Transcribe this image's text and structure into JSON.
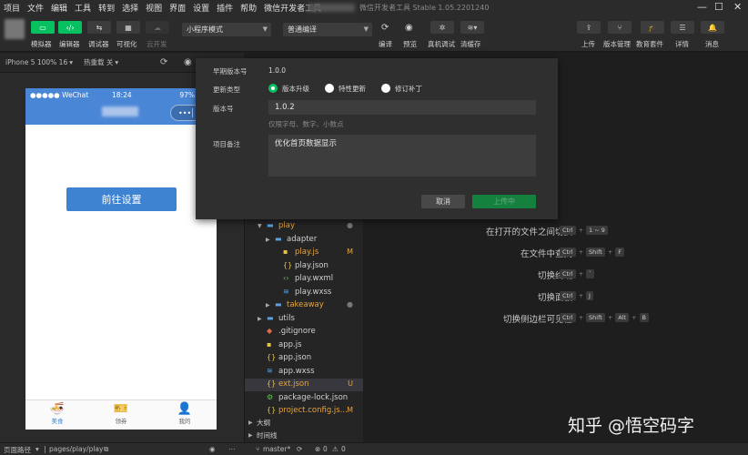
{
  "menubar": {
    "items": [
      "项目",
      "文件",
      "编辑",
      "工具",
      "转到",
      "选择",
      "视图",
      "界面",
      "设置",
      "插件",
      "帮助",
      "微信开发者工具"
    ],
    "app_title": "微信开发者工具 Stable 1.05.2201240"
  },
  "toolbar": {
    "simulator": "模拟器",
    "editor": "编辑器",
    "debugger": "调试器",
    "visual": "可视化",
    "cloud": "云开发",
    "mode_select": "小程序模式",
    "compile_select": "普通编译",
    "compile": "编译",
    "preview": "预览",
    "remote_debug": "真机调试",
    "clear_cache": "清缓存",
    "upload": "上传",
    "version": "版本管理",
    "edu": "教育套件",
    "details": "详情",
    "messages": "消息"
  },
  "simbar": {
    "device": "iPhone 5 100% 16",
    "hotreload": "热重载 关"
  },
  "phone": {
    "carrier": "●●●●● WeChat",
    "time": "18:24",
    "battery": "97%",
    "goto_button": "前往设置",
    "tabs": [
      {
        "icon": "bowl-icon",
        "glyph": "🍜",
        "label": "美食"
      },
      {
        "icon": "coupon-icon",
        "glyph": "🎫",
        "label": "领券"
      },
      {
        "icon": "user-icon",
        "glyph": "👤",
        "label": "我的"
      }
    ]
  },
  "filetree": {
    "rows": [
      {
        "name": "play",
        "kind": "folder",
        "status": "●"
      },
      {
        "name": "adapter",
        "kind": "folder",
        "status": ""
      },
      {
        "name": "play.js",
        "kind": "js",
        "status": "M"
      },
      {
        "name": "play.json",
        "kind": "json",
        "status": ""
      },
      {
        "name": "play.wxml",
        "kind": "wxml",
        "status": ""
      },
      {
        "name": "play.wxss",
        "kind": "wxss",
        "status": ""
      },
      {
        "name": "takeaway",
        "kind": "folder",
        "status": "●"
      },
      {
        "name": "utils",
        "kind": "folder",
        "status": ""
      },
      {
        "name": ".gitignore",
        "kind": "git",
        "status": ""
      },
      {
        "name": "app.js",
        "kind": "js",
        "status": ""
      },
      {
        "name": "app.json",
        "kind": "json",
        "status": ""
      },
      {
        "name": "app.wxss",
        "kind": "wxss",
        "status": ""
      },
      {
        "name": "ext.json",
        "kind": "json",
        "status": "U"
      },
      {
        "name": "package-lock.json",
        "kind": "pkg",
        "status": ""
      },
      {
        "name": "project.config.js...",
        "kind": "json",
        "status": "M"
      }
    ],
    "outline": "大纲",
    "timeline": "时间线"
  },
  "shortcuts": [
    {
      "label": "在打开的文件之间切换",
      "keys": [
        "Ctrl",
        "1 ~ 9"
      ]
    },
    {
      "label": "在文件中查找",
      "keys": [
        "Ctrl",
        "Shift",
        "F"
      ]
    },
    {
      "label": "切换终端",
      "keys": [
        "Ctrl",
        "`"
      ]
    },
    {
      "label": "切换面板",
      "keys": [
        "Ctrl",
        "J"
      ]
    },
    {
      "label": "切换侧边栏可见性",
      "keys": [
        "Ctrl",
        "Shift",
        "Alt",
        "B"
      ]
    }
  ],
  "dialog": {
    "last_version_label": "早期版本号",
    "last_version_value": "1.0.0",
    "update_type_label": "更新类型",
    "options": [
      "版本升级",
      "特性更新",
      "修订补丁"
    ],
    "selected_option": "版本升级",
    "version_label": "版本号",
    "version_value": "1.0.2",
    "version_hint": "仅限字母、数字、小数点",
    "note_label": "项目备注",
    "note_value": "优化首页数据显示",
    "cancel": "取消",
    "upload": "上传中"
  },
  "statusbar": {
    "page_path_label": "页面路径",
    "page_path": "pages/play/play",
    "branch": "master*",
    "errors": "0",
    "warnings": "0"
  },
  "watermark": "知乎 @悟空码字",
  "colors": {
    "accent_green": "#07c160",
    "phone_nav_blue": "#4a86d6",
    "button_blue": "#3e83d2"
  }
}
